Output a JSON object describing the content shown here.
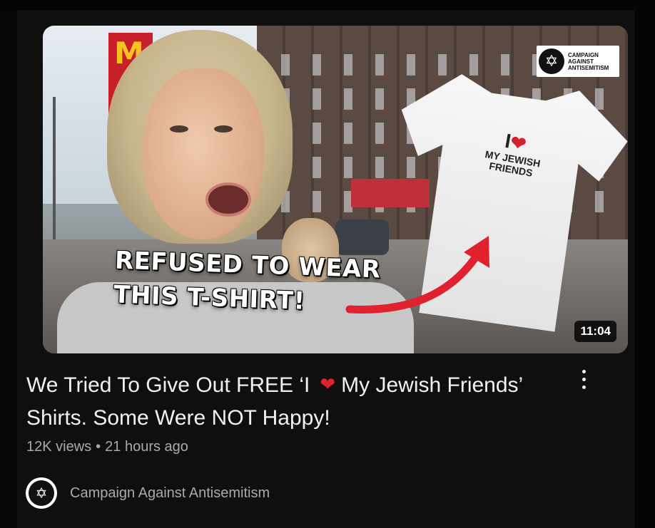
{
  "video": {
    "thumbnail": {
      "overlay_line1": "REFUSED TO WEAR",
      "overlay_line2": "THIS T-SHIRT!",
      "shirt_line1": "MY JEWISH",
      "shirt_line2": "FRIENDS",
      "shirt_i": "I",
      "logo_line1": "CAMPAIGN",
      "logo_line2": "AGAINST",
      "logo_line3": "ANTISEMITISM",
      "duration": "11:04"
    },
    "title_part1": "We Tried To Give Out FREE ‘I",
    "title_heart": "❤",
    "title_part2": "My Jewish Friends’ Shirts. Some Were NOT Happy!",
    "views": "12K views",
    "separator": "•",
    "age": "21 hours ago",
    "channel_name": "Campaign Against Antisemitism"
  },
  "icons": {
    "menu": "three-dots-vertical",
    "avatar": "star-of-david"
  },
  "colors": {
    "background": "#0f0f0f",
    "title_text": "#f1f1f1",
    "meta_text": "#aaaaaa",
    "heart": "#e0222e",
    "arrow": "#e0222e"
  }
}
